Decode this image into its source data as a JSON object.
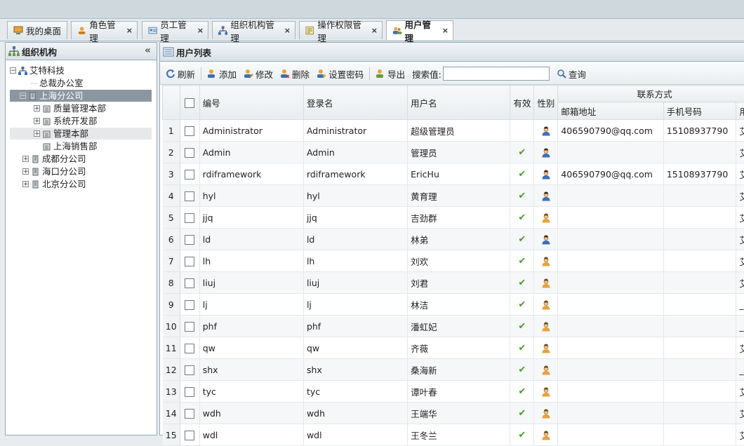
{
  "tabs": [
    {
      "label": "我的桌面",
      "icon": "desktop-icon",
      "closable": false
    },
    {
      "label": "角色管理",
      "icon": "role-icon",
      "closable": true
    },
    {
      "label": "员工管理",
      "icon": "staff-card-icon",
      "closable": true
    },
    {
      "label": "组织机构管理",
      "icon": "org-chart-icon",
      "closable": true
    },
    {
      "label": "操作权限管理",
      "icon": "permission-icon",
      "closable": true
    },
    {
      "label": "用户管理",
      "icon": "users-icon",
      "closable": true
    }
  ],
  "close_glyph": "×",
  "left_panel": {
    "title": "组织机构",
    "collapse_glyph": "«",
    "tree": [
      {
        "label": "艾特科技",
        "toggle": "−",
        "icon": "org-root-icon"
      },
      {
        "label": "总裁办公室",
        "toggle": "",
        "icon": ""
      },
      {
        "label": "上海分公司",
        "toggle": "−",
        "icon": "building-icon",
        "selected": true
      },
      {
        "label": "质量管理本部",
        "toggle": "+",
        "icon": "department-icon"
      },
      {
        "label": "系统开发部",
        "toggle": "+",
        "icon": "department-icon"
      },
      {
        "label": "管理本部",
        "toggle": "+",
        "icon": "department-icon",
        "hover": true
      },
      {
        "label": "上海销售部",
        "toggle": "",
        "icon": "department-icon"
      },
      {
        "label": "成都分公司",
        "toggle": "+",
        "icon": "building-icon"
      },
      {
        "label": "海口分公司",
        "toggle": "+",
        "icon": "building-icon"
      },
      {
        "label": "北京分公司",
        "toggle": "+",
        "icon": "building-icon"
      }
    ]
  },
  "right_panel": {
    "title": "用户列表",
    "toolbar": {
      "refresh": "刷新",
      "add": "添加",
      "edit": "修改",
      "delete": "删除",
      "set_password": "设置密码",
      "export": "导出",
      "search_label": "搜索值:",
      "search_value": "",
      "query": "查询"
    },
    "grid": {
      "group_header": "联系方式",
      "columns": {
        "code": "编号",
        "login": "登录名",
        "username": "用户名",
        "valid": "有效",
        "gender": "性别",
        "email": "邮箱地址",
        "mobile": "手机号码",
        "extra": "用"
      },
      "valid_glyph": "✔",
      "rows": [
        {
          "n": "1",
          "code": "Administrator",
          "login": "Administrator",
          "name": "超级管理员",
          "valid": false,
          "gender": "male",
          "email": "406590790@qq.com",
          "mobile": "15108937790",
          "extra": "艾"
        },
        {
          "n": "2",
          "code": "Admin",
          "login": "Admin",
          "name": "管理员",
          "valid": true,
          "gender": "male",
          "email": "",
          "mobile": "",
          "extra": "艾"
        },
        {
          "n": "3",
          "code": "rdiframework",
          "login": "rdiframework",
          "name": "EricHu",
          "valid": true,
          "gender": "male",
          "email": "406590790@qq.com",
          "mobile": "15108937790",
          "extra": "艾"
        },
        {
          "n": "4",
          "code": "hyl",
          "login": "hyl",
          "name": "黄育理",
          "valid": true,
          "gender": "male",
          "email": "",
          "mobile": "",
          "extra": "艾"
        },
        {
          "n": "5",
          "code": "jjq",
          "login": "jjq",
          "name": "吉劲群",
          "valid": true,
          "gender": "female",
          "email": "",
          "mobile": "",
          "extra": "艾"
        },
        {
          "n": "6",
          "code": "ld",
          "login": "ld",
          "name": "林弟",
          "valid": true,
          "gender": "male",
          "email": "",
          "mobile": "",
          "extra": "艾"
        },
        {
          "n": "7",
          "code": "lh",
          "login": "lh",
          "name": "刘欢",
          "valid": true,
          "gender": "female",
          "email": "",
          "mobile": "",
          "extra": "艾"
        },
        {
          "n": "8",
          "code": "liuj",
          "login": "liuj",
          "name": "刘君",
          "valid": true,
          "gender": "female",
          "email": "",
          "mobile": "",
          "extra": "艾"
        },
        {
          "n": "9",
          "code": "lj",
          "login": "lj",
          "name": "林洁",
          "valid": true,
          "gender": "female",
          "email": "",
          "mobile": "",
          "extra": "_"
        },
        {
          "n": "10",
          "code": "phf",
          "login": "phf",
          "name": "潘虹妃",
          "valid": true,
          "gender": "female",
          "email": "",
          "mobile": "",
          "extra": "_"
        },
        {
          "n": "11",
          "code": "qw",
          "login": "qw",
          "name": "齐薇",
          "valid": true,
          "gender": "female",
          "email": "",
          "mobile": "",
          "extra": "艾"
        },
        {
          "n": "12",
          "code": "shx",
          "login": "shx",
          "name": "桑海新",
          "valid": true,
          "gender": "female",
          "email": "",
          "mobile": "",
          "extra": "_"
        },
        {
          "n": "13",
          "code": "tyc",
          "login": "tyc",
          "name": "谭叶春",
          "valid": true,
          "gender": "female",
          "email": "",
          "mobile": "",
          "extra": "艾"
        },
        {
          "n": "14",
          "code": "wdh",
          "login": "wdh",
          "name": "王端华",
          "valid": true,
          "gender": "female",
          "email": "",
          "mobile": "",
          "extra": "艾"
        },
        {
          "n": "15",
          "code": "wdl",
          "login": "wdl",
          "name": "王冬兰",
          "valid": true,
          "gender": "female",
          "email": "",
          "mobile": "",
          "extra": "艾"
        }
      ]
    }
  },
  "colors": {
    "selected_node": "#8a97a0",
    "valid_check": "#4a9a2a",
    "male_avatar": "#3d6fb6",
    "female_avatar": "#e6a23c"
  }
}
